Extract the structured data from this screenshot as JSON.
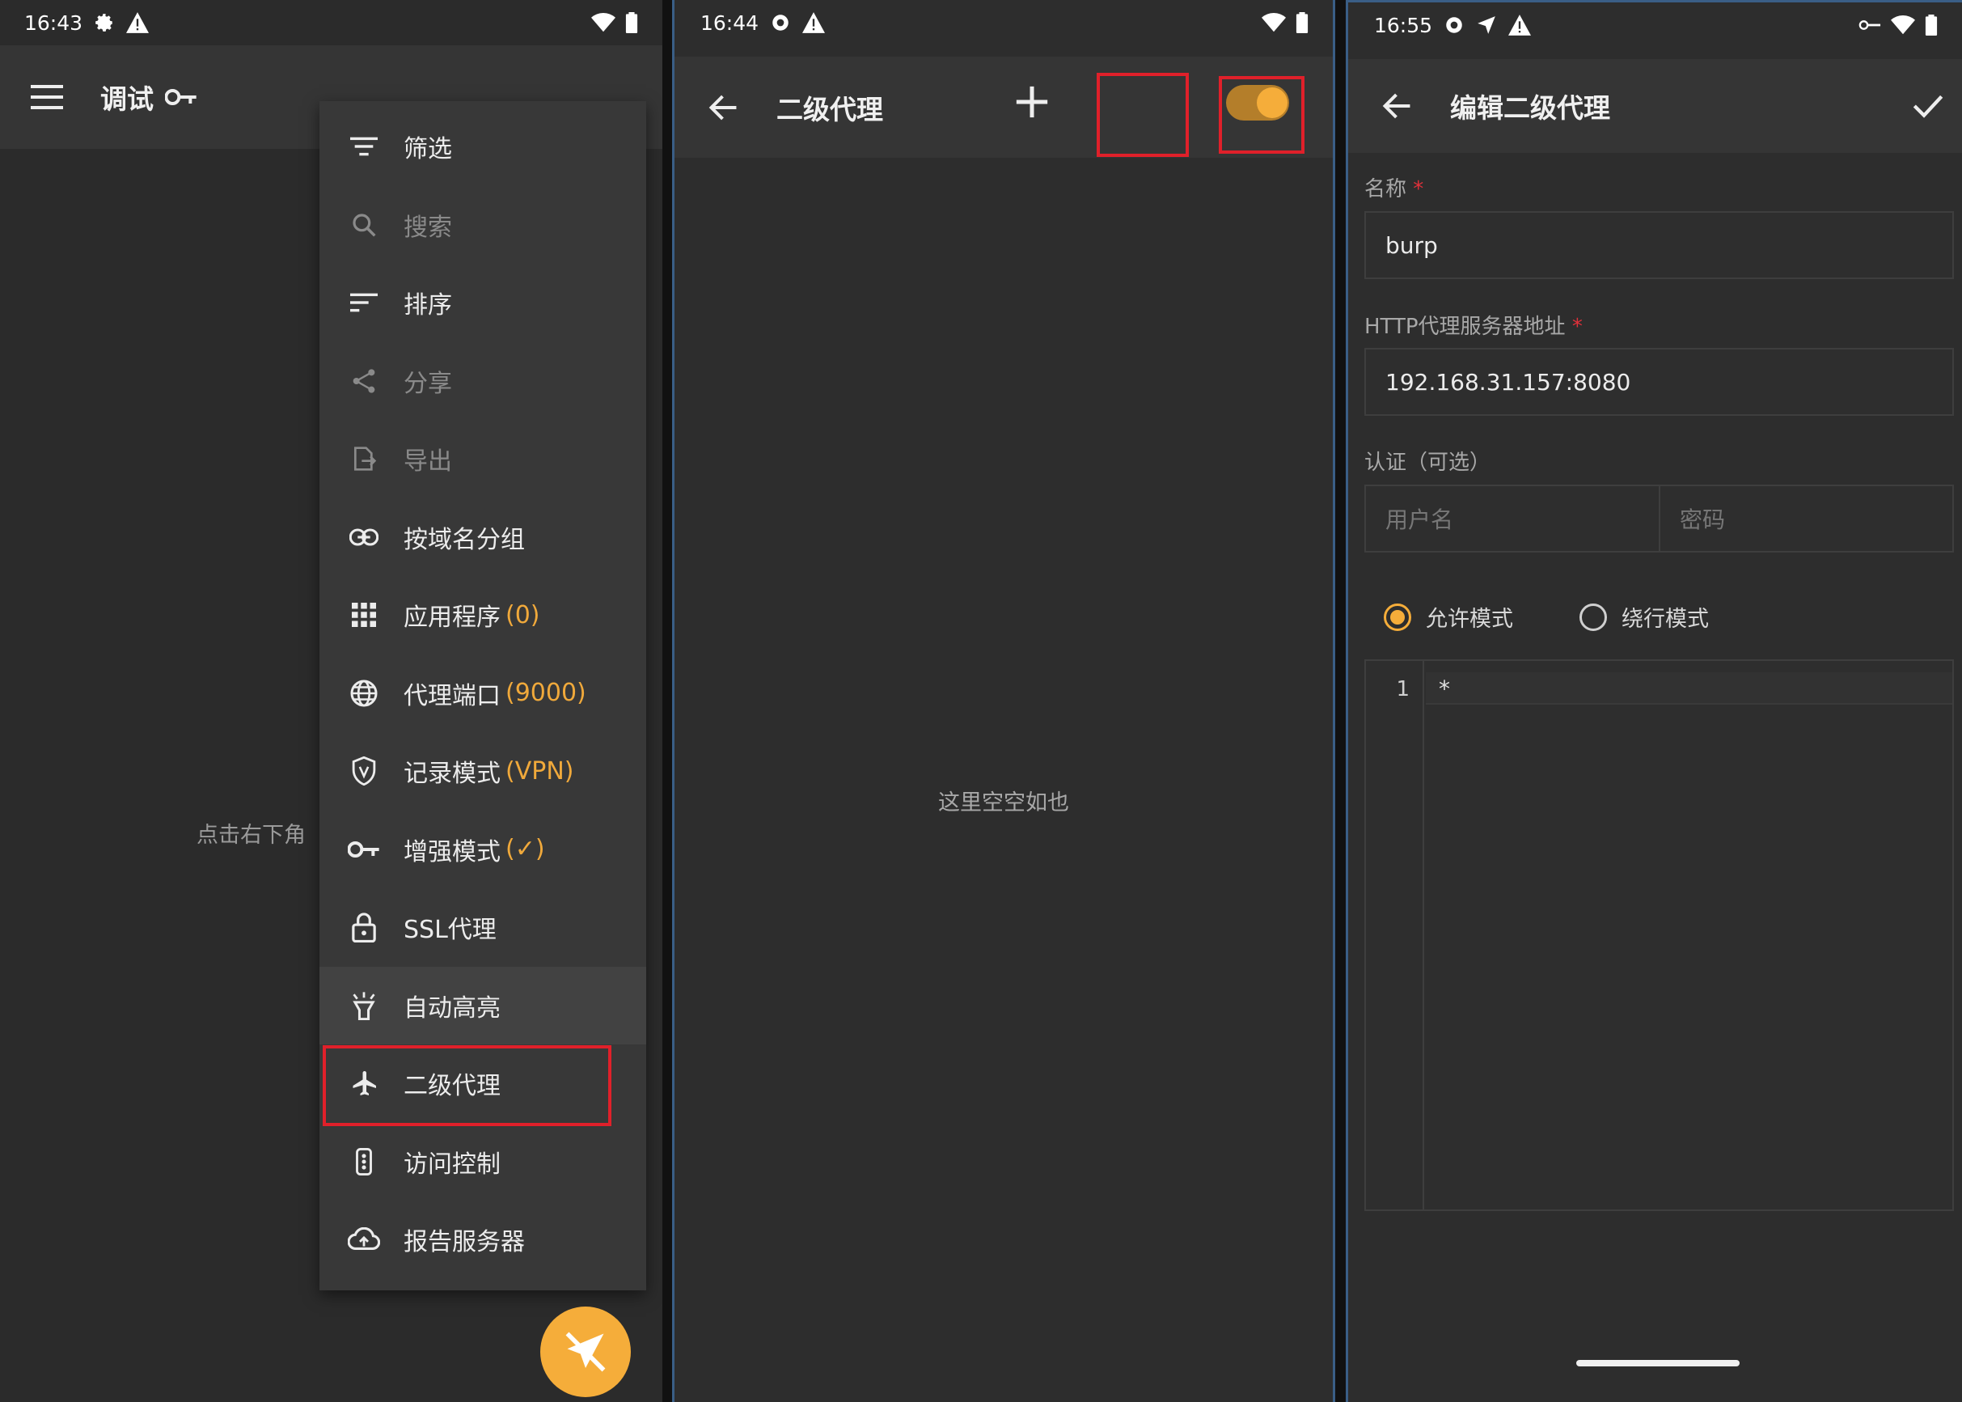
{
  "panel1": {
    "status_time": "16:43",
    "title": "调试",
    "body_text": "点击右下角",
    "menu": [
      {
        "label": "筛选",
        "icon": "filter-icon",
        "value": "",
        "dim": false
      },
      {
        "label": "搜索",
        "icon": "search-icon",
        "value": "",
        "dim": true
      },
      {
        "label": "排序",
        "icon": "sort-icon",
        "value": "",
        "dim": false
      },
      {
        "label": "分享",
        "icon": "share-icon",
        "value": "",
        "dim": true
      },
      {
        "label": "导出",
        "icon": "export-icon",
        "value": "",
        "dim": true
      },
      {
        "label": "按域名分组",
        "icon": "link-icon",
        "value": "",
        "dim": false
      },
      {
        "label": "应用程序",
        "icon": "grid-icon",
        "value": "(0)",
        "dim": false
      },
      {
        "label": "代理端口",
        "icon": "globe-icon",
        "value": "(9000)",
        "dim": false
      },
      {
        "label": "记录模式",
        "icon": "shield-icon",
        "value": "(VPN)",
        "dim": false
      },
      {
        "label": "增强模式",
        "icon": "key-icon",
        "value": "(✓)",
        "dim": false
      },
      {
        "label": "SSL代理",
        "icon": "lock-icon",
        "value": "",
        "dim": false
      },
      {
        "label": "自动高亮",
        "icon": "highlight-icon",
        "value": "",
        "dim": false
      },
      {
        "label": "二级代理",
        "icon": "airplane-icon",
        "value": "",
        "dim": false
      },
      {
        "label": "访问控制",
        "icon": "traffic-light-icon",
        "value": "",
        "dim": false
      },
      {
        "label": "报告服务器",
        "icon": "cloud-upload-icon",
        "value": "",
        "dim": false
      }
    ]
  },
  "panel2": {
    "status_time": "16:44",
    "title": "二级代理",
    "empty_text": "这里空空如也",
    "toggle_on": true
  },
  "panel3": {
    "status_time": "16:55",
    "title": "编辑二级代理",
    "name_label": "名称",
    "name_value": "burp",
    "http_label": "HTTP代理服务器地址",
    "http_value": "192.168.31.157:8080",
    "auth_label": "认证（可选）",
    "username_placeholder": "用户名",
    "password_placeholder": "密码",
    "mode_allow": "允许模式",
    "mode_bypass": "绕行模式",
    "editor_line_number": "1",
    "editor_line_text": "*",
    "required_mark": "*"
  },
  "colors": {
    "accent": "#f5ad3a",
    "highlight_box": "#e0202a",
    "required": "#e0303a"
  }
}
